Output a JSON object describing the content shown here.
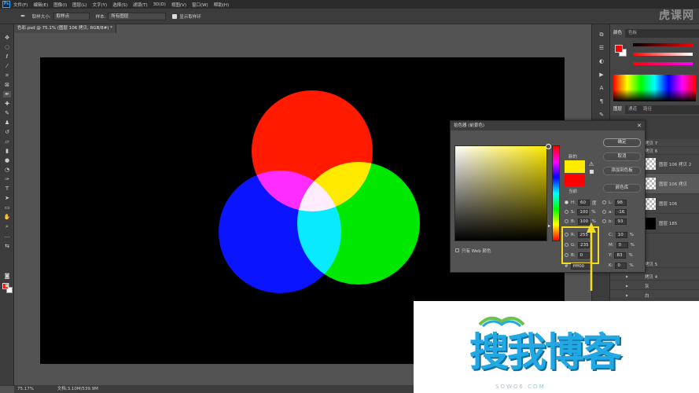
{
  "menubar": {
    "app_icon": "Ps",
    "items": [
      "文件(F)",
      "编辑(E)",
      "图像(I)",
      "图层(L)",
      "文字(Y)",
      "选择(S)",
      "滤镜(T)",
      "3D(D)",
      "视图(V)",
      "窗口(W)",
      "帮助(H)"
    ]
  },
  "optionsbar": {
    "sample_size_label": "取样大小:",
    "sample_size_value": "取样点",
    "sample_label": "样本:",
    "sample_value": "所有图层",
    "show_ring_label": "显示取样环"
  },
  "watermark_top": "虎课网",
  "document": {
    "tab_title": "色彩.psd @ 75.1% (图层 106 拷贝, RGB/8#) *",
    "zoom": "75.17%",
    "doc_size": "文档:3.10M/539.9M"
  },
  "panels": {
    "color_tabs": [
      "颜色",
      "色板"
    ],
    "layer_tabs": [
      "图层",
      "通道",
      "路径"
    ],
    "layers": [
      {
        "name": "拷贝 7",
        "thumb": "none"
      },
      {
        "name": "拷贝 6",
        "thumb": "none"
      },
      {
        "name": "图层 106 拷贝 2",
        "thumb": "checker"
      },
      {
        "name": "图层 106 拷贝",
        "thumb": "checker"
      },
      {
        "name": "图层 106",
        "thumb": "checker"
      },
      {
        "name": "图层 185",
        "thumb": "black"
      },
      {
        "name": "拷贝 5",
        "thumb": "none"
      },
      {
        "name": "拷贝 4",
        "thumb": "none"
      },
      {
        "name": "灰",
        "thumb": "folder"
      },
      {
        "name": "白",
        "thumb": "folder"
      }
    ]
  },
  "color_picker": {
    "title": "拾色器 (前景色)",
    "new_label": "新的",
    "current_label": "当前",
    "ok_label": "确定",
    "cancel_label": "取消",
    "add_swatch_label": "添加到色板",
    "libraries_label": "颜色库",
    "web_only_label": "只有 Web 颜色",
    "fields": {
      "H": {
        "label": "H:",
        "value": "60",
        "unit": "度"
      },
      "S": {
        "label": "S:",
        "value": "100",
        "unit": "%"
      },
      "B": {
        "label": "B:",
        "value": "100",
        "unit": "%"
      },
      "R": {
        "label": "R:",
        "value": "255"
      },
      "G": {
        "label": "G:",
        "value": "235"
      },
      "Bb": {
        "label": "B:",
        "value": "0"
      },
      "L": {
        "label": "L:",
        "value": "98"
      },
      "a": {
        "label": "a:",
        "value": "-16"
      },
      "b": {
        "label": "b:",
        "value": "93"
      },
      "C": {
        "label": "C:",
        "value": "10",
        "unit": "%"
      },
      "M": {
        "label": "M:",
        "value": "0",
        "unit": "%"
      },
      "Y": {
        "label": "Y:",
        "value": "83",
        "unit": "%"
      },
      "K": {
        "label": "K:",
        "value": "0",
        "unit": "%"
      }
    },
    "hex_label": "#",
    "hex_value": "ffff00",
    "new_color": "#ffeb00",
    "current_color": "#ff0000"
  },
  "canvas_colors": {
    "red": "#ff1a00",
    "green": "#00e800",
    "blue": "#0a14ff"
  },
  "logo": {
    "text": "搜我博客",
    "sub": "SOWO6.COM"
  }
}
